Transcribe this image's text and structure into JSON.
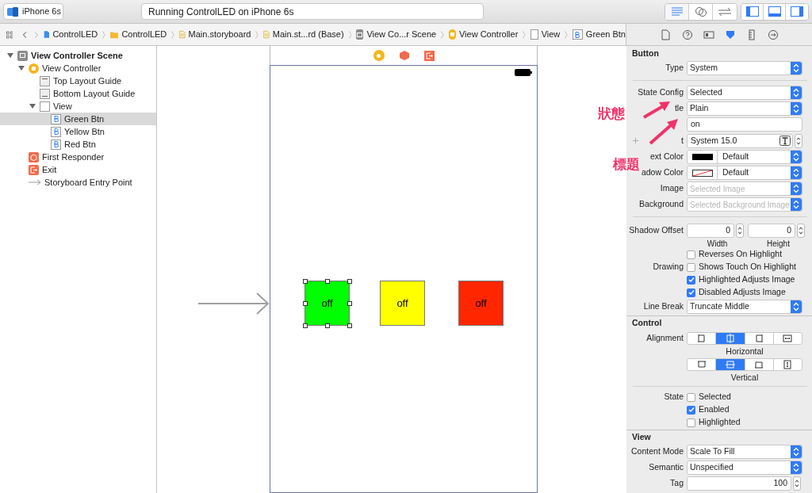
{
  "toolbar": {
    "scheme": "iPhone 6s",
    "activity": "Running ControlLED on iPhone 6s",
    "editor_modes": [
      {
        "kind": "standard",
        "selected": true
      },
      {
        "kind": "assistant",
        "selected": false
      },
      {
        "kind": "version",
        "selected": false
      }
    ],
    "panels": [
      {
        "kind": "left",
        "selected": true
      },
      {
        "kind": "bottom",
        "selected": true
      },
      {
        "kind": "right",
        "selected": true
      }
    ]
  },
  "jump_bar": [
    {
      "label": "ControlLED",
      "kind": "project"
    },
    {
      "label": "ControlLED",
      "kind": "folder"
    },
    {
      "label": "Main.storyboard",
      "kind": "storyboard"
    },
    {
      "label": "Main.st...rd (Base)",
      "kind": "storyboard"
    },
    {
      "label": "View Co...r Scene",
      "kind": "scene"
    },
    {
      "label": "View Controller",
      "kind": "controller"
    },
    {
      "label": "View",
      "kind": "view"
    },
    {
      "label": "Green Btn",
      "kind": "button"
    }
  ],
  "inspector_tabs": [
    {
      "kind": "file",
      "selected": false
    },
    {
      "kind": "help",
      "selected": false
    },
    {
      "kind": "identity",
      "selected": false
    },
    {
      "kind": "attributes",
      "selected": true
    },
    {
      "kind": "size",
      "selected": false
    },
    {
      "kind": "connections",
      "selected": false
    }
  ],
  "navigator": [
    {
      "label": "View Controller Scene",
      "kind": "scene",
      "expanded": true,
      "selected": false,
      "children": [
        {
          "label": "View Controller",
          "kind": "controller",
          "expanded": true,
          "selected": false,
          "children": [
            {
              "label": "Top Layout Guide",
              "kind": "top-guide",
              "selected": false
            },
            {
              "label": "Bottom Layout Guide",
              "kind": "bottom-guide",
              "selected": false
            },
            {
              "label": "View",
              "kind": "view",
              "expanded": true,
              "selected": false,
              "children": [
                {
                  "label": "Green Btn",
                  "kind": "button",
                  "selected": true
                },
                {
                  "label": "Yellow Btn",
                  "kind": "button",
                  "selected": false
                },
                {
                  "label": "Red Btn",
                  "kind": "button",
                  "selected": false
                }
              ]
            }
          ]
        },
        {
          "label": "First Responder",
          "kind": "responder",
          "selected": false
        },
        {
          "label": "Exit",
          "kind": "exit",
          "selected": false
        },
        {
          "label": "Storyboard Entry Point",
          "kind": "entry",
          "selected": false
        }
      ]
    }
  ],
  "canvas": {
    "buttons": [
      {
        "label": "off",
        "color": "#00ff00",
        "selected": true
      },
      {
        "label": "off",
        "color": "#ffff00",
        "selected": false
      },
      {
        "label": "off",
        "color": "#ff2600",
        "selected": false
      }
    ]
  },
  "inspector": [
    {
      "title": "Button",
      "rows": [
        {
          "kind": "popup",
          "label": "Type",
          "value": "System"
        },
        {
          "kind": "divider"
        },
        {
          "kind": "popup",
          "label": "State Config",
          "value": "Selected"
        },
        {
          "kind": "popup",
          "label": "tle",
          "value": "Plain"
        },
        {
          "kind": "text",
          "value": "on"
        },
        {
          "kind": "font",
          "label": "t",
          "value": "System 15.0"
        },
        {
          "kind": "color",
          "label": "ext Color",
          "value": "Default",
          "cleared": false
        },
        {
          "kind": "color",
          "label": "adow Color",
          "value": "Default",
          "cleared": true
        },
        {
          "kind": "popup",
          "label": "Image",
          "placeholder": "Selected Image"
        },
        {
          "kind": "popup",
          "label": "Background",
          "placeholder": "Selected Background Image"
        },
        {
          "kind": "divider"
        },
        {
          "kind": "pair",
          "label": "Shadow Offset",
          "values": [
            "0",
            "0"
          ],
          "captions": [
            "Width",
            "Height"
          ]
        },
        {
          "kind": "check",
          "text": "Reverses On Highlight",
          "checked": false
        },
        {
          "kind": "check",
          "label": "Drawing",
          "text": "Shows Touch On Highlight",
          "checked": false
        },
        {
          "kind": "check",
          "text": "Highlighted Adjusts Image",
          "checked": true
        },
        {
          "kind": "check",
          "text": "Disabled Adjusts Image",
          "checked": true
        },
        {
          "kind": "popup",
          "label": "Line Break",
          "value": "Truncate Middle"
        }
      ]
    },
    {
      "title": "Control",
      "rows": [
        {
          "kind": "hsegments",
          "label": "Alignment",
          "caption": "Horizontal",
          "segments": [
            {
              "selected": false
            },
            {
              "selected": true
            },
            {
              "selected": false
            },
            {
              "selected": false
            }
          ]
        },
        {
          "kind": "vsegments",
          "caption": "Vertical",
          "segments": [
            {
              "selected": false
            },
            {
              "selected": true
            },
            {
              "selected": false
            },
            {
              "selected": false
            }
          ]
        },
        {
          "kind": "divider"
        },
        {
          "kind": "check",
          "label": "State",
          "text": "Selected",
          "checked": false
        },
        {
          "kind": "check",
          "text": "Enabled",
          "checked": true
        },
        {
          "kind": "check",
          "text": "Highlighted",
          "checked": false
        }
      ]
    },
    {
      "title": "View",
      "rows": [
        {
          "kind": "popup",
          "label": "Content Mode",
          "value": "Scale To Fill"
        },
        {
          "kind": "popup",
          "label": "Semantic",
          "value": "Unspecified"
        },
        {
          "kind": "number",
          "label": "Tag",
          "value": "100"
        }
      ]
    }
  ],
  "annotations": [
    {
      "text": "狀態"
    },
    {
      "text": "標題"
    }
  ]
}
